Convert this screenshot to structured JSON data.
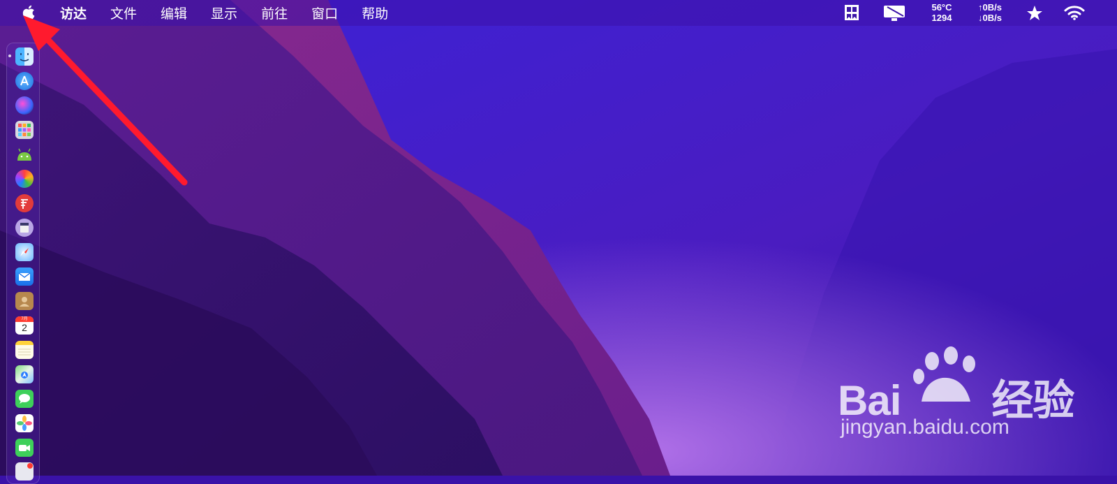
{
  "menubar": {
    "apple_icon": "apple-logo-icon",
    "items": [
      "访达",
      "文件",
      "编辑",
      "显示",
      "前往",
      "窗口",
      "帮助"
    ],
    "status": {
      "temp": "56°C",
      "fan": "1294",
      "net_up": "↑0B/s",
      "net_down": "↓0B/s"
    },
    "status_icons": [
      "window-grid-icon",
      "display-mirroring-icon",
      "star-icon",
      "wifi-icon"
    ]
  },
  "dock": {
    "apps": [
      "finder",
      "app-store",
      "siri",
      "launchpad",
      "android-studio",
      "pinwheel-app",
      "red-app",
      "notes-app",
      "safari",
      "mail",
      "contacts",
      "calendar",
      "notes",
      "maps",
      "messages",
      "photos",
      "facetime"
    ],
    "calendar": {
      "month": "7月",
      "day": "2"
    }
  },
  "watermark": {
    "brand": "Bai",
    "brand_suffix": "经验",
    "url": "jingyan.baidu.com"
  },
  "colors": {
    "annotation_arrow": "#ff1a2e",
    "wallpaper_base": "#3a12a8"
  }
}
